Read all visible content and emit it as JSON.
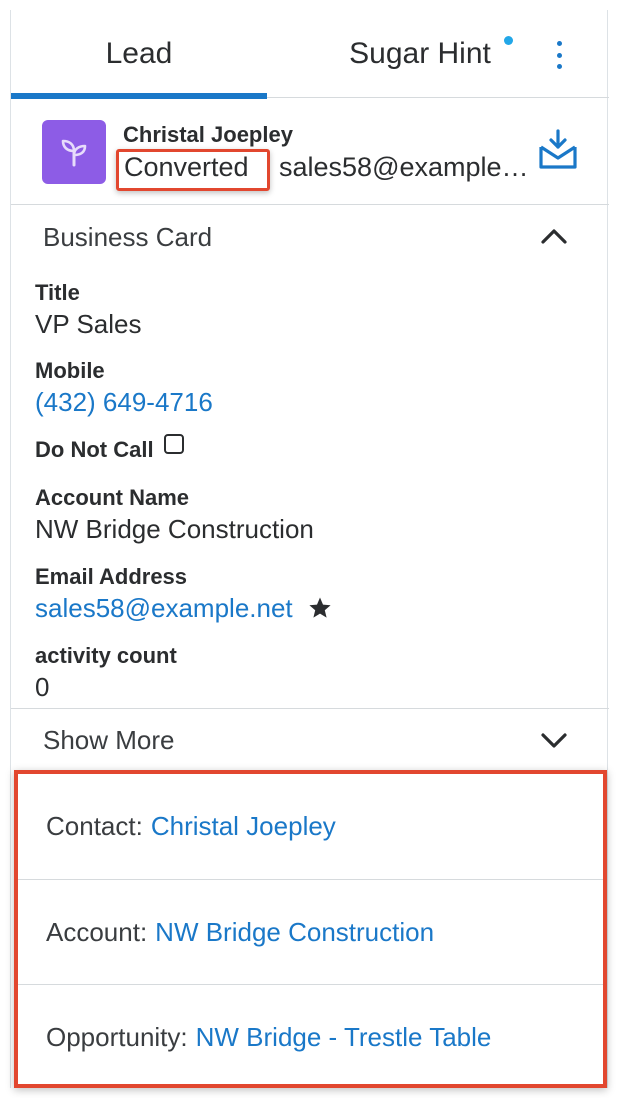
{
  "tabs": {
    "lead": "Lead",
    "sugar_hint": "Sugar Hint"
  },
  "record": {
    "name": "Christal Joepley",
    "status": "Converted",
    "email": "sales58@example.net"
  },
  "business_card": {
    "heading": "Business Card",
    "fields": {
      "title_label": "Title",
      "title_value": "VP Sales",
      "mobile_label": "Mobile",
      "mobile_value": "(432) 649-4716",
      "do_not_call_label": "Do Not Call",
      "account_label": "Account Name",
      "account_value": "NW Bridge Construction",
      "email_label": "Email Address",
      "email_value": "sales58@example.net",
      "activity_label": "activity count",
      "activity_value": "0"
    },
    "show_more": "Show More"
  },
  "converted_records": {
    "contact_label": "Contact:",
    "contact_value": "Christal Joepley",
    "account_label": "Account:",
    "account_value": "NW Bridge Construction",
    "opportunity_label": "Opportunity:",
    "opportunity_value": "NW Bridge - Trestle Table"
  },
  "colors": {
    "accent": "#1a78c8",
    "avatar": "#8d5ce6",
    "highlight": "#e2472f",
    "notification_dot": "#22a7e8"
  },
  "icons": {
    "avatar": "sprout-icon",
    "import": "import-tray-icon",
    "collapse": "chevron-up-icon",
    "expand": "chevron-down-icon",
    "favorite": "star-icon",
    "menu": "kebab-menu-icon"
  }
}
